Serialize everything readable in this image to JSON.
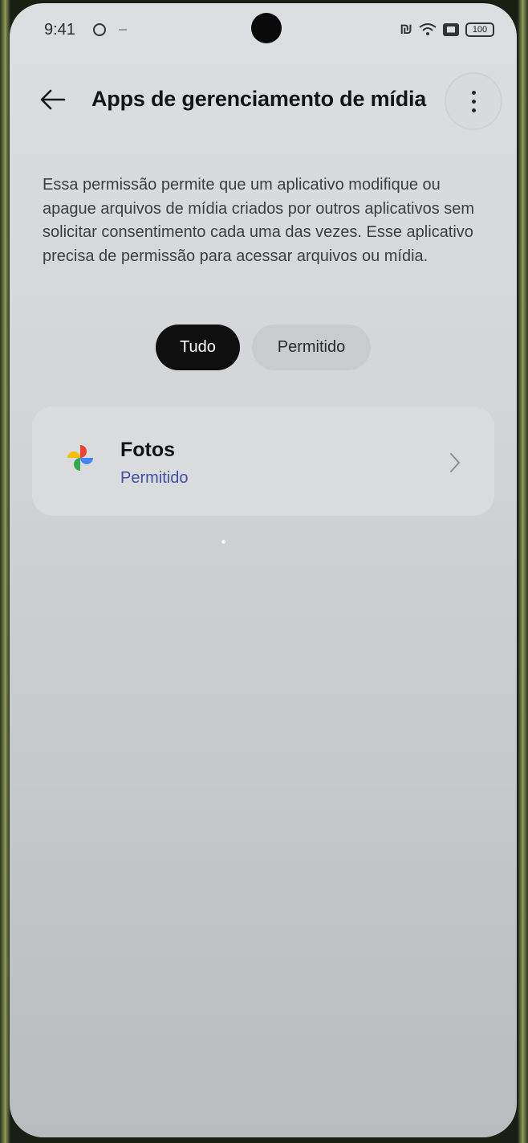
{
  "status_bar": {
    "time": "9:41",
    "battery": "100",
    "icons": [
      "alarm-icon",
      "nfc-icon",
      "wifi-icon",
      "sim-off-icon",
      "battery-icon"
    ]
  },
  "header": {
    "title": "Apps de gerenciamento de mídia",
    "back_icon": "arrow-left-icon",
    "menu_icon": "more-vertical-icon"
  },
  "description": "Essa permissão permite que um aplicativo modifique ou apague arquivos de mídia criados por outros aplicativos sem solicitar consentimento cada uma das vezes. Esse aplicativo precisa de permissão para acessar arquivos ou mídia.",
  "filters": {
    "selected": "Tudo",
    "options": [
      "Tudo",
      "Permitido"
    ]
  },
  "apps": [
    {
      "name": "Fotos",
      "status": "Permitido",
      "icon": "google-photos-icon"
    }
  ],
  "colors": {
    "accent_status": "#3f4fa3",
    "chip_selected_bg": "#0f0f0f"
  }
}
